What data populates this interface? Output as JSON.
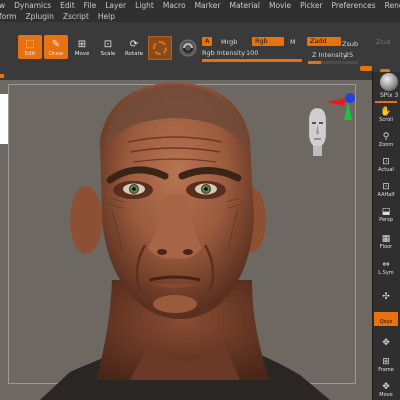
{
  "menu": {
    "row1": [
      "w",
      "Dynamics",
      "Edit",
      "File",
      "Layer",
      "Light",
      "Macro",
      "Marker",
      "Material",
      "Movie",
      "Picker",
      "Preferences",
      "Render"
    ],
    "row2": [
      "form",
      "Zplugin",
      "Zscript",
      "Help"
    ]
  },
  "toolbar": {
    "edit_label": "Edit",
    "draw_label": "Draw",
    "move_label": "Move",
    "scale_label": "Scale",
    "rotate_label": "Rotate",
    "a_label": "A",
    "mrgb_label": "Mrgb",
    "rgb_label": "Rgb",
    "m_label": "M",
    "zadd_label": "Zadd",
    "zsub_label": "Zsub",
    "zcut_label": "Zcut",
    "rgb_intensity_label": "Rgb Intensity",
    "rgb_intensity_value": "100",
    "z_intensity_label": "Z Intensity",
    "z_intensity_value": "25",
    "rgb_intensity_level": 1.0,
    "z_intensity_level": 0.25
  },
  "rightbar": {
    "spix_label": "SPix",
    "spix_value": "3",
    "buttons": [
      "Scroll",
      "Zoom",
      "Actual",
      "AAHalf",
      "Persp",
      "Floor",
      "L.Sym",
      "",
      "Qxyz",
      "",
      "Frame",
      "Move"
    ]
  },
  "colors": {
    "accent": "#e8720f",
    "viewport_bg": "#6d6862",
    "panel_bg": "#3a3a3a",
    "skin": "#a86446"
  }
}
